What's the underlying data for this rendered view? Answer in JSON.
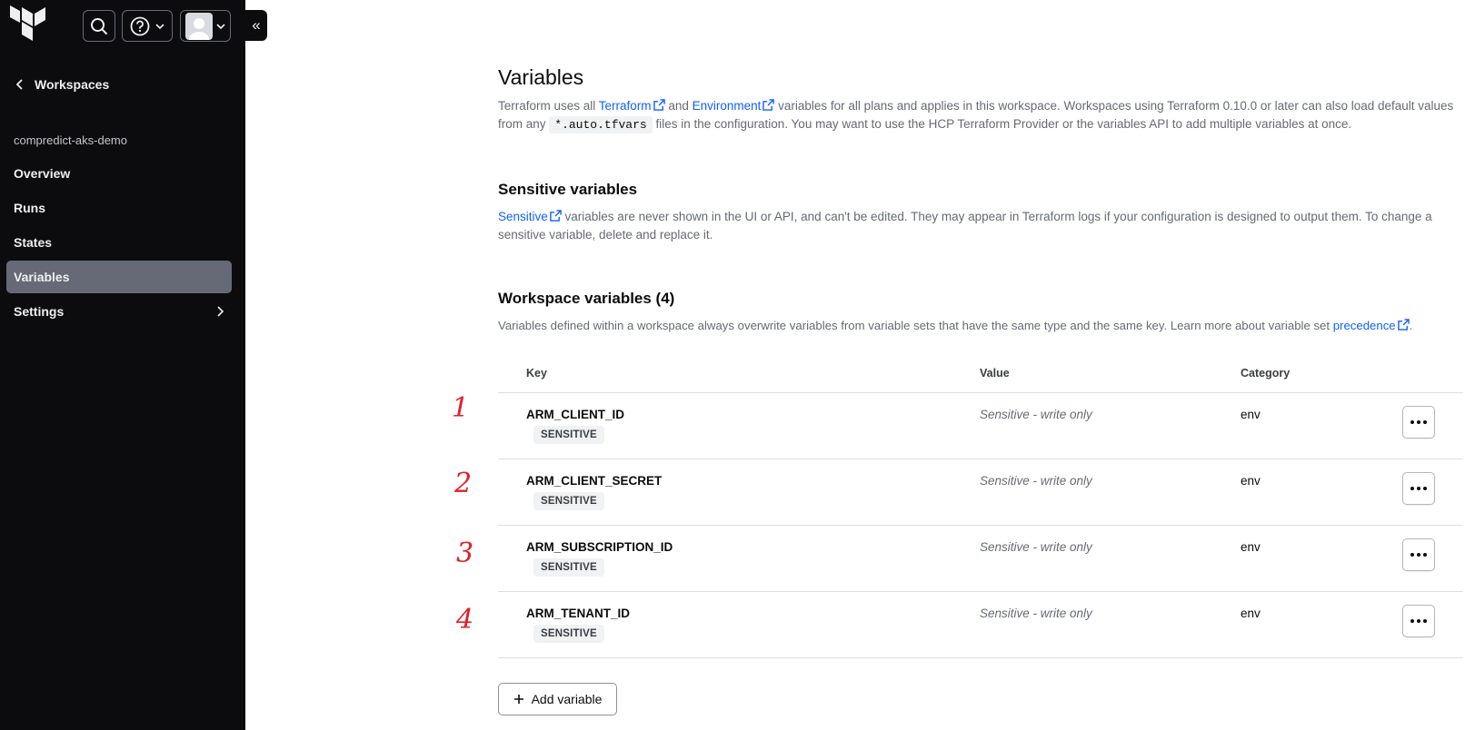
{
  "sidebar": {
    "back_label": "Workspaces",
    "workspace_name": "compredict-aks-demo",
    "nav": [
      {
        "label": "Overview"
      },
      {
        "label": "Runs"
      },
      {
        "label": "States"
      },
      {
        "label": "Variables",
        "active": true
      },
      {
        "label": "Settings",
        "has_submenu": true
      }
    ],
    "collapse_glyph": "«"
  },
  "page": {
    "title": "Variables",
    "intro": {
      "t1": "Terraform uses all ",
      "link1": "Terraform",
      "t2": " and ",
      "link2": "Environment",
      "t3": " variables for all plans and applies in this workspace. Workspaces using Terraform 0.10.0 or later can also load default values from any ",
      "code": "*.auto.tfvars",
      "t4": " files in the configuration. You may want to use the HCP Terraform Provider or the variables API to add multiple variables at once."
    },
    "sensitive": {
      "heading": "Sensitive variables",
      "link": "Sensitive",
      "text": " variables are never shown in the UI or API, and can't be edited. They may appear in Terraform logs if your configuration is designed to output them. To change a sensitive variable, delete and replace it."
    },
    "workspace_vars": {
      "heading": "Workspace variables (4)",
      "text": "Variables defined within a workspace always overwrite variables from variable sets that have the same type and the same key. Learn more about variable set ",
      "link": "precedence",
      "text_end": "."
    },
    "table": {
      "headers": {
        "key": "Key",
        "value": "Value",
        "category": "Category"
      },
      "rows": [
        {
          "key": "ARM_CLIENT_ID",
          "badge": "SENSITIVE",
          "value": "Sensitive - write only",
          "category": "env"
        },
        {
          "key": "ARM_CLIENT_SECRET",
          "badge": "SENSITIVE",
          "value": "Sensitive - write only",
          "category": "env"
        },
        {
          "key": "ARM_SUBSCRIPTION_ID",
          "badge": "SENSITIVE",
          "value": "Sensitive - write only",
          "category": "env"
        },
        {
          "key": "ARM_TENANT_ID",
          "badge": "SENSITIVE",
          "value": "Sensitive - write only",
          "category": "env"
        }
      ]
    },
    "add_button": "Add variable"
  },
  "annotations": [
    "1",
    "2",
    "3",
    "4"
  ],
  "colors": {
    "sidebar_bg": "#0c0c0e",
    "active_nav": "#656a76",
    "link": "#1060ff",
    "annotation": "#e0202a"
  }
}
